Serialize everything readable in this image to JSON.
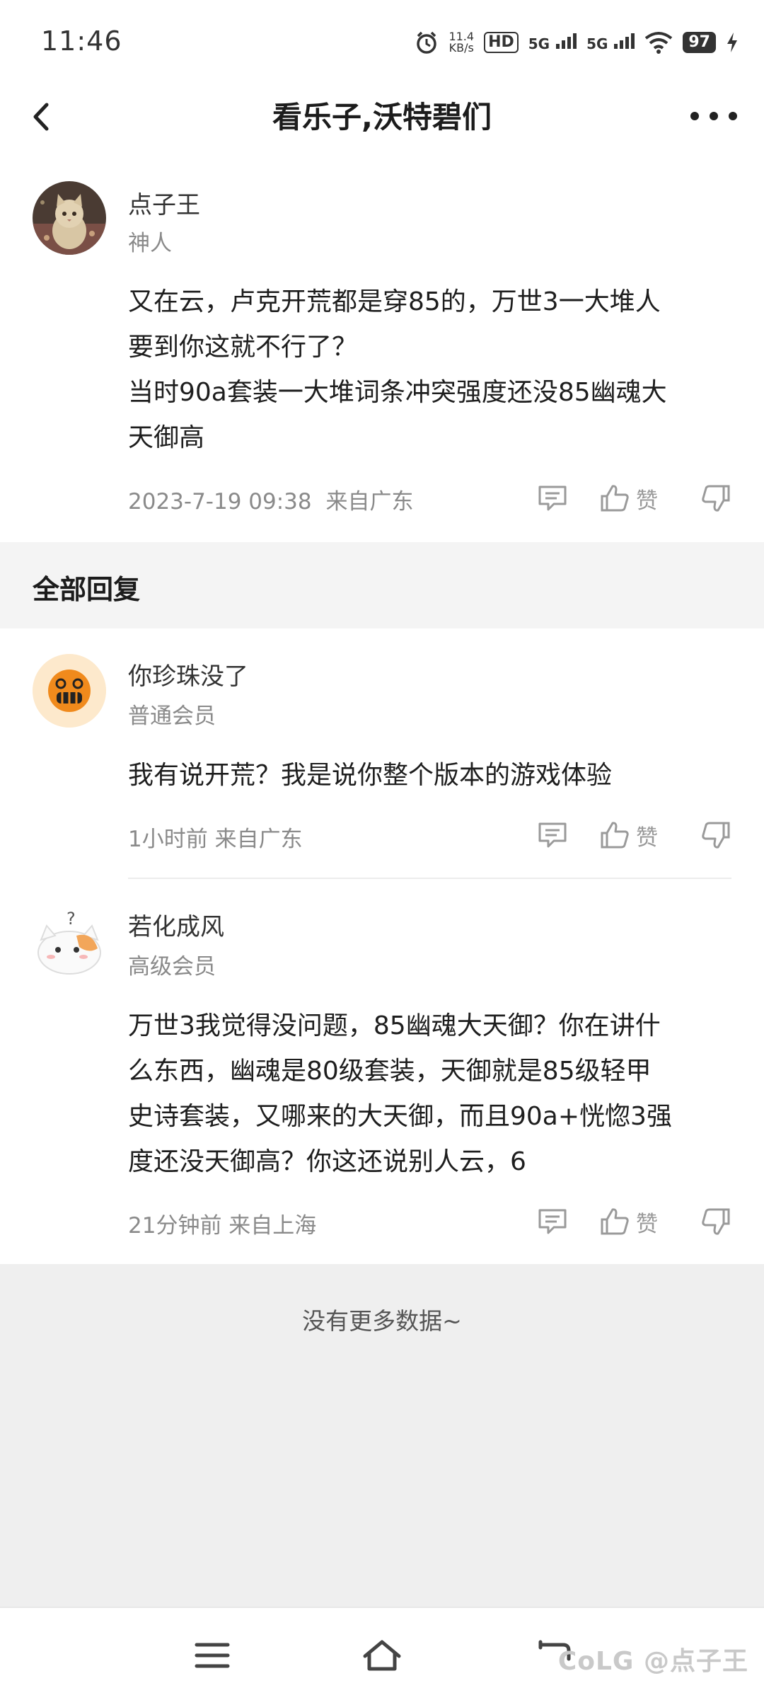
{
  "status_bar": {
    "time": "11:46",
    "net_speed_value": "11.4",
    "net_speed_unit": "KB/s",
    "hd": "HD",
    "sig1": "5G",
    "sig2": "5G",
    "battery": "97"
  },
  "header": {
    "title": "看乐子,沃特碧们"
  },
  "main_post": {
    "username": "点子王",
    "rank": "神人",
    "content_lines": [
      "又在云，卢克开荒都是穿85的，万世3一大堆人",
      "要到你这就不行了？",
      "当时90a套装一大堆词条冲突强度还没85幽魂大",
      "天御高"
    ],
    "timestamp": "2023-7-19 09:38",
    "location": "来自广东",
    "like_label": "赞"
  },
  "section_title": "全部回复",
  "replies": [
    {
      "username": "你珍珠没了",
      "rank": "普通会员",
      "content_lines": [
        "我有说开荒？我是说你整个版本的游戏体验"
      ],
      "time": "1小时前 来自广东",
      "like_label": "赞"
    },
    {
      "username": "若化成风",
      "rank": "高级会员",
      "content_lines": [
        "万世3我觉得没问题，85幽魂大天御？你在讲什",
        "么东西，幽魂是80级套装，天御就是85级轻甲",
        "史诗套装，又哪来的大天御，而且90a+恍惚3强",
        "度还没天御高？你这还说别人云，6"
      ],
      "time": "21分钟前 来自上海",
      "like_label": "赞"
    }
  ],
  "no_more": "没有更多数据~",
  "watermark": "CoLG @点子王",
  "colors": {
    "section_bg": "#f4f4f4",
    "footer_bg": "#efefef",
    "muted_text": "#8a8a8a"
  }
}
